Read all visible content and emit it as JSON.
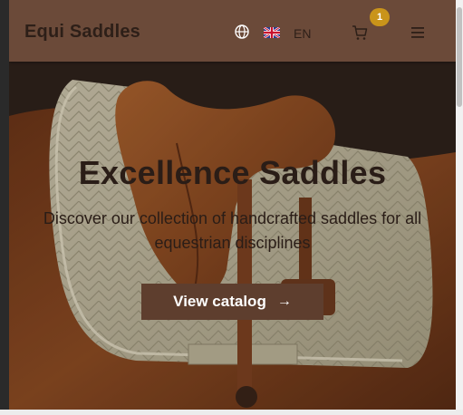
{
  "header": {
    "logo": "Equi Saddles",
    "language_code": "EN",
    "cart_count": "1"
  },
  "hero": {
    "title": "Excellence Saddles",
    "subtitle": "Discover our collection of handcrafted saddles for all equestrian disciplines",
    "cta_label": "View catalog"
  },
  "icons": {
    "globe": "globe-icon",
    "flag": "uk-flag-icon",
    "cart": "cart-icon",
    "menu": "hamburger-menu-icon",
    "cta_arrow": "arrow-right-icon"
  },
  "colors": {
    "header_bg": "#6b4a39",
    "cta_bg": "#5e3e2e",
    "badge_bg": "#c9941a",
    "text_dark": "#2a1d17"
  }
}
